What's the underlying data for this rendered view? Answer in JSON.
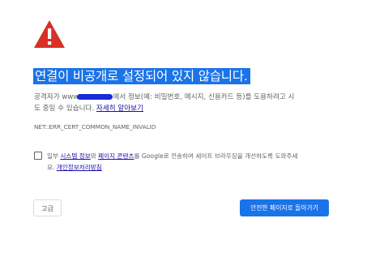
{
  "colors": {
    "accent": "#1a73e8",
    "warning": "#d93025",
    "text": "#5f6368"
  },
  "icon": {
    "name": "warning-triangle-icon"
  },
  "title": "연결이 비공개로 설정되어 있지 않습니다.",
  "body": {
    "text_prefix": "공격자가 www",
    "text_after_host": "에서 정보(예: 비밀번호, 메시지, 신용카드 등)를 도용하려고 시",
    "line2_text": "도 중일 수 있습니다.",
    "learn_more_link": "자세히 알아보기"
  },
  "error_code": "NET::ERR_CERT_COMMON_NAME_INVALID",
  "optin": {
    "text_prefix": "일부 ",
    "link_system_info": "시스템 정보",
    "text_and": "와 ",
    "link_page_content": "페이지 콘텐츠",
    "text_rest": "를 Google로 전송하여 세이프 브라우징을 개선하도록 도와주세",
    "line2_prefix": "요. ",
    "link_privacy": "개인정보처리방침"
  },
  "buttons": {
    "advanced": "고급",
    "back_to_safety": "안전한 페이지로 돌아가기"
  }
}
